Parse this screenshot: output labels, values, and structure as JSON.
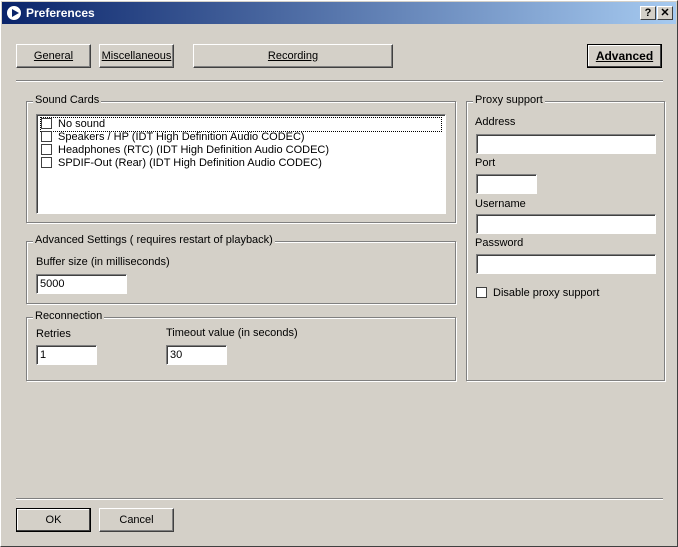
{
  "window": {
    "title": "Preferences",
    "help_label": "?",
    "close_label": "✕"
  },
  "tabs": [
    {
      "label": "General"
    },
    {
      "label": "Miscellaneous"
    },
    {
      "label": "Recording"
    },
    {
      "label": "Advanced",
      "selected": true
    }
  ],
  "sound_cards": {
    "legend": "Sound Cards",
    "items": [
      {
        "label": "No sound",
        "checked": false,
        "focused": true
      },
      {
        "label": "Speakers / HP (IDT High Definition Audio CODEC)",
        "checked": false
      },
      {
        "label": "Headphones (RTC) (IDT High Definition Audio CODEC)",
        "checked": false
      },
      {
        "label": "SPDIF-Out (Rear) (IDT High Definition Audio CODEC)",
        "checked": false
      }
    ]
  },
  "advanced_settings": {
    "legend": "Advanced Settings ( requires restart of playback)",
    "buffer_label": "Buffer size (in milliseconds)",
    "buffer_value": "5000"
  },
  "reconnection": {
    "legend": "Reconnection",
    "retries_label": "Retries",
    "retries_value": "1",
    "timeout_label": "Timeout value (in seconds)",
    "timeout_value": "30"
  },
  "proxy": {
    "legend": "Proxy support",
    "address_label": "Address",
    "address_value": "",
    "port_label": "Port",
    "port_value": "",
    "username_label": "Username",
    "username_value": "",
    "password_label": "Password",
    "password_value": "",
    "disable_label": "Disable proxy support",
    "disable_checked": false
  },
  "footer": {
    "ok_label": "OK",
    "cancel_label": "Cancel"
  }
}
